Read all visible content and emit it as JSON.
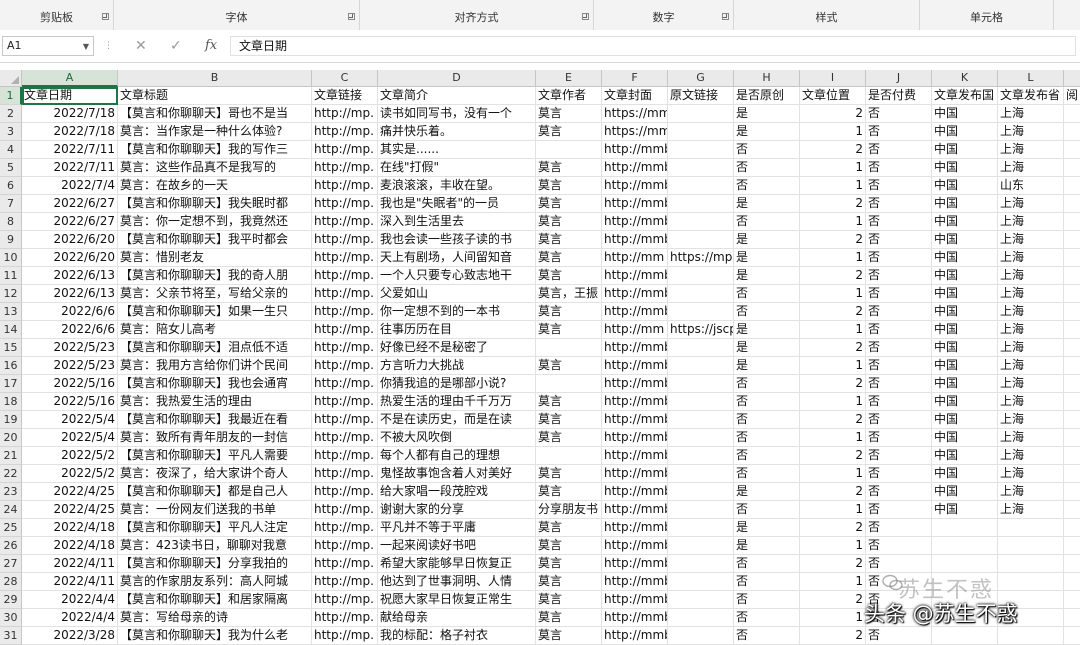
{
  "ribbon": {
    "groups": [
      {
        "label": "剪贴板",
        "launcher": true
      },
      {
        "label": "字体",
        "launcher": true
      },
      {
        "label": "对齐方式",
        "launcher": true
      },
      {
        "label": "数字",
        "launcher": true
      },
      {
        "label": "样式",
        "launcher": false
      },
      {
        "label": "单元格",
        "launcher": false
      }
    ]
  },
  "formula_bar": {
    "name_box": "A1",
    "formula": "文章日期"
  },
  "columns": [
    "A",
    "B",
    "C",
    "D",
    "E",
    "F",
    "G",
    "H",
    "I",
    "J",
    "K",
    "L"
  ],
  "rows": [
    [
      "1",
      "文章日期",
      "文章标题",
      "文章链接",
      "文章简介",
      "文章作者",
      "文章封面",
      "原文链接",
      "是否原创",
      "文章位置",
      "是否付费",
      "文章发布国",
      "文章发布省",
      "阅"
    ],
    [
      "2",
      "2022/7/18",
      "【莫言和你聊聊天】哥也不是当",
      "http://mp.",
      "读书如同写书，没有一个",
      "莫言",
      "https://mmbiz.qpic.cr",
      "",
      "是",
      "2",
      "否",
      "中国",
      "上海",
      ""
    ],
    [
      "3",
      "2022/7/18",
      "莫言：当作家是一种什么体验?",
      "http://mp.",
      "痛并快乐着。",
      "莫言",
      "https://mmbiz.qpic.cr",
      "",
      "是",
      "1",
      "否",
      "中国",
      "上海",
      ""
    ],
    [
      "4",
      "2022/7/11",
      "【莫言和你聊聊天】我的写作三",
      "http://mp.",
      "其实是......",
      "",
      "http://mmbiz.qpic.cn/",
      "",
      "否",
      "2",
      "否",
      "中国",
      "上海",
      ""
    ],
    [
      "5",
      "2022/7/11",
      "莫言：这些作品真不是我写的",
      "http://mp.",
      "在线\"打假\"",
      "莫言",
      "http://mmbiz.qpic.cn/",
      "",
      "否",
      "1",
      "否",
      "中国",
      "上海",
      ""
    ],
    [
      "6",
      "2022/7/4",
      "莫言：在故乡的一天",
      "http://mp.",
      "麦浪滚滚，丰收在望。",
      "莫言",
      "http://mmbiz.qpic.cn/",
      "",
      "否",
      "1",
      "否",
      "中国",
      "山东",
      ""
    ],
    [
      "7",
      "2022/6/27",
      "【莫言和你聊聊天】我失眠时都",
      "http://mp.",
      "我也是\"失眠者\"的一员",
      "莫言",
      "http://mmbiz.qpic.cn/",
      "",
      "是",
      "2",
      "否",
      "中国",
      "上海",
      ""
    ],
    [
      "8",
      "2022/6/27",
      "莫言：你一定想不到，我竟然还",
      "http://mp.",
      "深入到生活里去",
      "莫言",
      "http://mmbiz.qpic.cn/",
      "",
      "否",
      "1",
      "否",
      "中国",
      "上海",
      ""
    ],
    [
      "9",
      "2022/6/20",
      "【莫言和你聊聊天】我平时都会",
      "http://mp.",
      "我也会读一些孩子读的书",
      "莫言",
      "http://mmbiz.qpic.cn/",
      "",
      "是",
      "2",
      "否",
      "中国",
      "上海",
      ""
    ],
    [
      "10",
      "2022/6/20",
      "莫言：惜别老友",
      "http://mp.",
      "天上有剧场，人间留知音",
      "莫言",
      "http://mm",
      "https://mp",
      "是",
      "1",
      "否",
      "中国",
      "上海",
      ""
    ],
    [
      "11",
      "2022/6/13",
      "【莫言和你聊聊天】我的奇人朋",
      "http://mp.",
      "一个人只要专心致志地干",
      "莫言",
      "http://mmbiz.qpic.cn/",
      "",
      "是",
      "2",
      "否",
      "中国",
      "上海",
      ""
    ],
    [
      "12",
      "2022/6/13",
      "莫言：父亲节将至，写给父亲的",
      "http://mp.",
      "父爱如山",
      "莫言，王振",
      "http://mmbiz.qpic.cn/",
      "",
      "否",
      "1",
      "否",
      "中国",
      "上海",
      ""
    ],
    [
      "13",
      "2022/6/6",
      "【莫言和你聊聊天】如果一生只",
      "http://mp.",
      "你一定想不到的一本书",
      "莫言",
      "http://mmbiz.qpic.cn/",
      "",
      "否",
      "2",
      "否",
      "中国",
      "上海",
      ""
    ],
    [
      "14",
      "2022/6/6",
      "莫言：陪女儿高考",
      "http://mp.",
      "往事历历在目",
      "莫言",
      "http://mm",
      "https://jscp",
      "是",
      "1",
      "否",
      "中国",
      "上海",
      ""
    ],
    [
      "15",
      "2022/5/23",
      "【莫言和你聊聊天】泪点低不适",
      "http://mp.",
      "好像已经不是秘密了",
      "",
      "http://mmbiz.qpic.cn/",
      "",
      "是",
      "2",
      "否",
      "中国",
      "上海",
      ""
    ],
    [
      "16",
      "2022/5/23",
      "莫言：我用方言给你们讲个民间",
      "http://mp.",
      "方言听力大挑战",
      "莫言",
      "http://mmbiz.qpic.cn/",
      "",
      "是",
      "1",
      "否",
      "中国",
      "上海",
      ""
    ],
    [
      "17",
      "2022/5/16",
      "【莫言和你聊聊天】我也会通宵",
      "http://mp.",
      "你猜我追的是哪部小说?",
      "",
      "http://mmbiz.qpic.cn/",
      "",
      "否",
      "2",
      "否",
      "中国",
      "上海",
      ""
    ],
    [
      "18",
      "2022/5/16",
      "莫言：我热爱生活的理由",
      "http://mp.",
      "热爱生活的理由千千万万",
      "莫言",
      "http://mmbiz.qpic.cn/",
      "",
      "否",
      "1",
      "否",
      "中国",
      "上海",
      ""
    ],
    [
      "19",
      "2022/5/4",
      "【莫言和你聊聊天】我最近在看",
      "http://mp.",
      "不是在读历史，而是在读",
      "莫言",
      "http://mmbiz.qpic.cn/",
      "",
      "否",
      "2",
      "否",
      "中国",
      "上海",
      ""
    ],
    [
      "20",
      "2022/5/4",
      "莫言：致所有青年朋友的一封信",
      "http://mp.",
      "不被大风吹倒",
      "莫言",
      "http://mmbiz.qpic.cn/",
      "",
      "否",
      "1",
      "否",
      "中国",
      "上海",
      ""
    ],
    [
      "21",
      "2022/5/2",
      "【莫言和你聊聊天】平凡人需要",
      "http://mp.",
      "每个人都有自己的理想",
      "",
      "http://mmbiz.qpic.cn/",
      "",
      "否",
      "2",
      "否",
      "中国",
      "上海",
      ""
    ],
    [
      "22",
      "2022/5/2",
      "莫言：夜深了，给大家讲个奇人",
      "http://mp.",
      "鬼怪故事饱含着人对美好",
      "莫言",
      "http://mmbiz.qpic.cn/",
      "",
      "否",
      "1",
      "否",
      "中国",
      "上海",
      ""
    ],
    [
      "23",
      "2022/4/25",
      "【莫言和你聊聊天】都是自己人",
      "http://mp.",
      "给大家唱一段茂腔戏",
      "莫言",
      "http://mmbiz.qpic.cn/",
      "",
      "是",
      "2",
      "否",
      "中国",
      "上海",
      ""
    ],
    [
      "24",
      "2022/4/25",
      "莫言：一份网友们送我的书单",
      "http://mp.",
      "谢谢大家的分享",
      "分享朋友书",
      "http://mmbiz.qpic.cn/",
      "",
      "否",
      "1",
      "否",
      "中国",
      "上海",
      ""
    ],
    [
      "25",
      "2022/4/18",
      "【莫言和你聊聊天】平凡人注定",
      "http://mp.",
      "平凡并不等于平庸",
      "莫言",
      "http://mmbiz.qpic.cn/",
      "",
      "是",
      "2",
      "否",
      "",
      "",
      ""
    ],
    [
      "26",
      "2022/4/18",
      "莫言：423读书日，聊聊对我意",
      "http://mp.",
      "一起来阅读好书吧",
      "莫言",
      "http://mmbiz.qpic.cn/",
      "",
      "是",
      "1",
      "否",
      "",
      "",
      ""
    ],
    [
      "27",
      "2022/4/11",
      "【莫言和你聊聊天】分享我拍的",
      "http://mp.",
      "希望大家能够早日恢复正",
      "莫言",
      "http://mmbiz.qpic.cn/",
      "",
      "否",
      "2",
      "否",
      "",
      "",
      ""
    ],
    [
      "28",
      "2022/4/11",
      "莫言的作家朋友系列：高人阿城",
      "http://mp.",
      "他达到了世事洞明、人情",
      "莫言",
      "http://mmbiz.qpic.cn/",
      "",
      "否",
      "1",
      "否",
      "",
      "",
      ""
    ],
    [
      "29",
      "2022/4/4",
      "【莫言和你聊聊天】和居家隔离",
      "http://mp.",
      "祝愿大家早日恢复正常生",
      "莫言",
      "http://mmbiz.qpic.cn/",
      "",
      "否",
      "2",
      "否",
      "",
      "",
      ""
    ],
    [
      "30",
      "2022/4/4",
      "莫言：写给母亲的诗",
      "http://mp.",
      "献给母亲",
      "莫言",
      "http://mmbiz.qpic.cn/",
      "",
      "否",
      "1",
      "否",
      "",
      "",
      ""
    ],
    [
      "31",
      "2022/3/28",
      "【莫言和你聊聊天】我为什么老",
      "http://mp.",
      "我的标配：格子衬衣",
      "莫言",
      "http://mmbiz.qpic.cn/",
      "",
      "否",
      "2",
      "否",
      "",
      "",
      ""
    ]
  ],
  "watermark": {
    "ghost": "苏生不惑",
    "text": "头条 @苏生不惑"
  }
}
